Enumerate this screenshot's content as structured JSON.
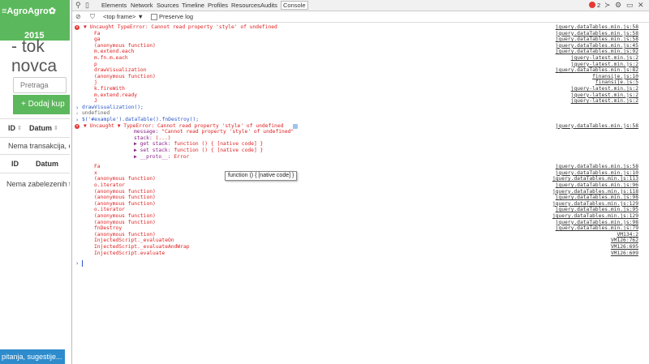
{
  "app": {
    "brand": "≡AgroAgro✿",
    "year": "2015",
    "title_line1": "- tok",
    "title_line2": "novca",
    "search_placeholder": "Pretraga",
    "add_button": "+ Dodaj kup",
    "table1": {
      "col_id": "ID",
      "col_datum": "Datum",
      "empty": "Nema transakcija, c"
    },
    "table2": {
      "col_id": "ID",
      "col_datum": "Datum"
    },
    "no_entries": "Nema zabelezenih tr",
    "feedback_tab": "pitanja, sugestije..."
  },
  "devtools": {
    "tabs": [
      "Elements",
      "Network",
      "Sources",
      "Timeline",
      "Profiles",
      "Resources",
      "Audits",
      "Console"
    ],
    "active_tab": "Console",
    "error_count": "2",
    "frame_select": "<top frame>",
    "preserve_log": "Preserve log",
    "tooltip": "function () { [native code] }",
    "lines": [
      {
        "kind": "error-head",
        "text": "▼ Uncaught TypeError: Cannot read property 'style' of undefined",
        "src": "jquery.dataTables.min.js:58"
      },
      {
        "text": "Fa",
        "src": "jquery.dataTables.min.js:58"
      },
      {
        "text": "ga",
        "src": "jquery.dataTables.min.js:58"
      },
      {
        "text": "(anonymous function)",
        "src": "jquery.dataTables.min.js:45"
      },
      {
        "text": "m.extend.each",
        "src": "jquery.dataTables.min.js:92"
      },
      {
        "text": "m.fn.m.each",
        "src": "jquery-latest.min.js:2"
      },
      {
        "text": "p",
        "src": "jquery-latest.min.js:2"
      },
      {
        "text": "drawVisualization",
        "src": "jquery.dataTables.min.js:82"
      },
      {
        "text": "(anonymous function)",
        "src": "finansije.js:10"
      },
      {
        "text": "j",
        "src": "finansije.js:5"
      },
      {
        "text": "k.fireWith",
        "src": "jquery-latest.min.js:2"
      },
      {
        "text": "m.extend.ready",
        "src": "jquery-latest.min.js:2"
      },
      {
        "text": "J",
        "src": "jquery-latest.min.js:2"
      },
      {
        "kind": "input",
        "text": "drawVisualization();"
      },
      {
        "kind": "output",
        "text": "undefined"
      },
      {
        "kind": "input",
        "text": "$('#example').dataTable().fnDestroy();"
      },
      {
        "kind": "error-head",
        "text": "▼ Uncaught ▼ TypeError: Cannot read property 'style' of undefined",
        "src": "jquery.dataTables.min.js:58"
      },
      {
        "kind": "prop",
        "key": "message:",
        "value": "\"Cannot read property 'style' of undefined\""
      },
      {
        "kind": "prop",
        "key": "stack:",
        "value": "(...)"
      },
      {
        "kind": "prop",
        "key": "▶ get stack:",
        "value": "function () { [native code] }"
      },
      {
        "kind": "prop",
        "key": "▶ set stack:",
        "value": "function () { [native code] }"
      },
      {
        "kind": "prop",
        "key": "▶ __proto__:",
        "value": "Error"
      },
      {
        "kind": "spacer"
      },
      {
        "text": "Fa",
        "src": "jquery.dataTables.min.js:58"
      },
      {
        "text": "x",
        "src": "jquery.dataTables.min.js:10"
      },
      {
        "text": "(anonymous function)",
        "src": "jquery.dataTables.min.js:113"
      },
      {
        "text": "o.iterator",
        "src": "jquery.dataTables.min.js:96"
      },
      {
        "text": "(anonymous function)",
        "src": "jquery.dataTables.min.js:118"
      },
      {
        "text": "(anonymous function)",
        "src": "jquery.dataTables.min.js:98"
      },
      {
        "text": "(anonymous function)",
        "src": "jquery.dataTables.min.js:129"
      },
      {
        "text": "o.iterator",
        "src": "jquery.dataTables.min.js:95"
      },
      {
        "text": "(anonymous function)",
        "src": "jquery.dataTables.min.js:129"
      },
      {
        "text": "(anonymous function)",
        "src": "jquery.dataTables.min.js:98"
      },
      {
        "text": "fnDestroy",
        "src": "jquery.dataTables.min.js:79"
      },
      {
        "text": "(anonymous function)",
        "src": "VM134:2"
      },
      {
        "text": "InjectedScript._evaluateOn",
        "src": "VM126:762"
      },
      {
        "text": "InjectedScript._evaluateAndWrap",
        "src": "VM126:695"
      },
      {
        "text": "InjectedScript.evaluate",
        "src": "VM126:609"
      },
      {
        "kind": "spacer"
      },
      {
        "kind": "prompt"
      }
    ]
  }
}
